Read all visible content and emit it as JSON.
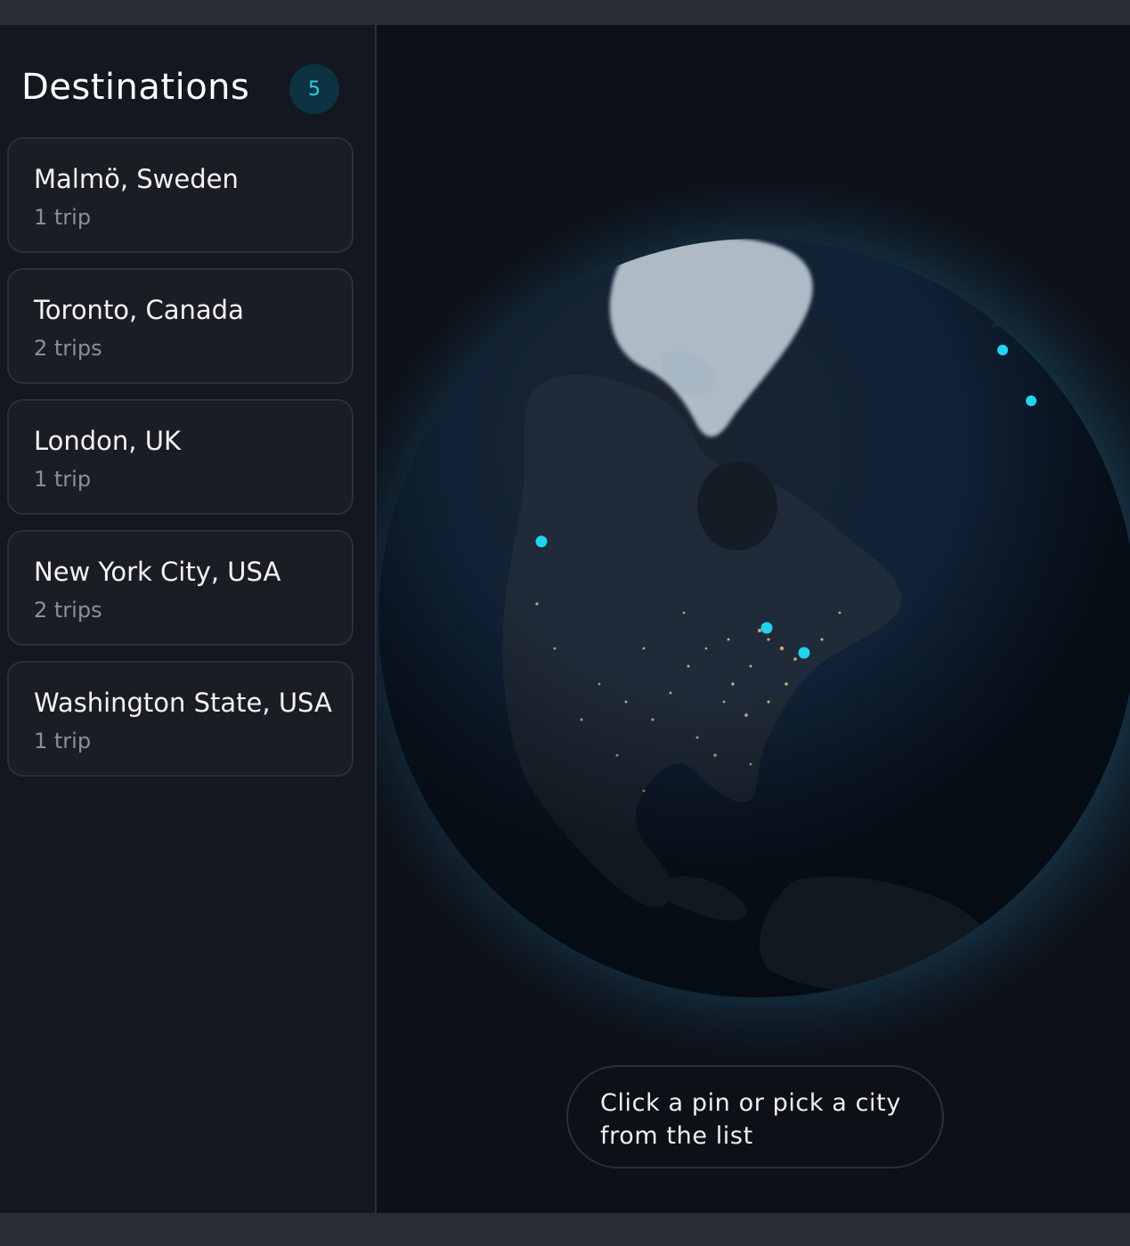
{
  "sidebar": {
    "title": "Destinations",
    "count": "5",
    "destinations": [
      {
        "name": "Malmö, Sweden",
        "trips": "1 trip"
      },
      {
        "name": "Toronto, Canada",
        "trips": "2 trips"
      },
      {
        "name": "London, UK",
        "trips": "1 trip"
      },
      {
        "name": "New York City, USA",
        "trips": "2 trips"
      },
      {
        "name": "Washington State, USA",
        "trips": "1 trip"
      }
    ]
  },
  "map": {
    "hint": "Click a pin or pick a city from the list",
    "pin_color": "#22d3ee",
    "pins": [
      "malmo-pin",
      "london-pin",
      "washington-state-pin",
      "toronto-pin",
      "new-york-city-pin"
    ]
  },
  "colors": {
    "accent": "#22d3ee",
    "panel_bg": "#13171f",
    "card_bg": "#1a1d24",
    "map_bg": "#0d1016"
  }
}
